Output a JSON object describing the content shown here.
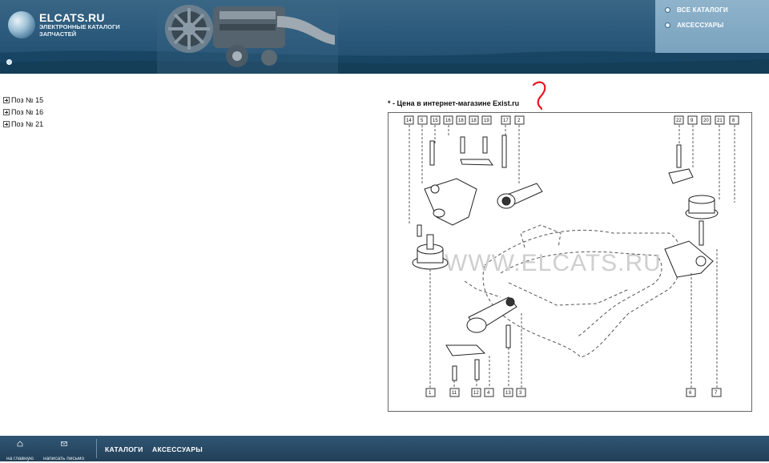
{
  "header": {
    "brand": "ELCATS.RU",
    "subtitle_line1": "ЭЛЕКТРОННЫЕ КАТАЛОГИ",
    "subtitle_line2": "ЗАПЧАСТЕЙ",
    "right_menu": [
      {
        "label": "ВСЕ КАТАЛОГИ",
        "icon": "bullet-icon"
      },
      {
        "label": "АКСЕССУАРЫ",
        "icon": "bullet-icon"
      }
    ]
  },
  "tree": {
    "items": [
      {
        "label": "Поз № 15"
      },
      {
        "label": "Поз № 16"
      },
      {
        "label": "Поз № 21"
      }
    ]
  },
  "diagram": {
    "note": "* - Цена в интернет-магазине Exist.ru",
    "watermark": "WWW.ELCATS.RU",
    "top_labels": [
      "14",
      "5",
      "15",
      "16",
      "18",
      "18",
      "19",
      "17",
      "2",
      "22",
      "9",
      "20",
      "21",
      "8"
    ],
    "bottom_labels": [
      "1",
      "11",
      "12",
      "4",
      "13",
      "3",
      "6",
      "7"
    ]
  },
  "footer": {
    "home_label": "на главную",
    "mail_label": "написать письмо",
    "links": [
      "КАТАЛОГИ",
      "АКСЕССУАРЫ"
    ]
  },
  "colors": {
    "header": "#2b5a7c",
    "footer": "#233f57",
    "annotation": "#e8141e"
  }
}
